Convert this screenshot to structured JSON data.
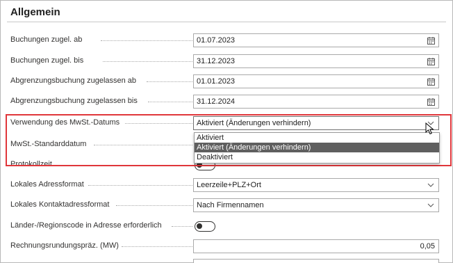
{
  "section": {
    "title": "Allgemein"
  },
  "fields": {
    "buchungen_ab": {
      "label": "Buchungen zugel. ab",
      "value": "01.07.2023"
    },
    "buchungen_bis": {
      "label": "Buchungen zugel. bis",
      "value": "31.12.2023"
    },
    "abgrenzung_ab": {
      "label": "Abgrenzungsbuchung zugelassen ab",
      "value": "01.01.2023"
    },
    "abgrenzung_bis": {
      "label": "Abgrenzungsbuchung zugelassen bis",
      "value": "31.12.2024"
    },
    "mwst_datum": {
      "label": "Verwendung des MwSt.-Datums",
      "value": "Aktiviert (Änderungen verhindern)"
    },
    "mwst_standard": {
      "label": "MwSt.-Standarddatum"
    },
    "protokollzeit": {
      "label": "Protokollzeit"
    },
    "adressformat": {
      "label": "Lokales Adressformat",
      "value": "Leerzeile+PLZ+Ort"
    },
    "kontaktadressformat": {
      "label": "Lokales Kontaktadressformat",
      "value": "Nach Firmennamen"
    },
    "laendercode": {
      "label": "Länder-/Regionscode in Adresse erforderlich"
    },
    "rundung": {
      "label": "Rechnungsrundungspräz. (MW)",
      "value": "0,05"
    }
  },
  "dropdown": {
    "options": [
      "Aktiviert",
      "Aktiviert (Änderungen verhindern)",
      "Deaktiviert"
    ],
    "selected_index": 1
  },
  "icons": {
    "calendar": "calendar-icon",
    "chevron": "chevron-down-icon",
    "cursor": "mouse-pointer-icon"
  },
  "colors": {
    "highlight": "#e0363a",
    "selected_option_bg": "#5f5f5f"
  }
}
